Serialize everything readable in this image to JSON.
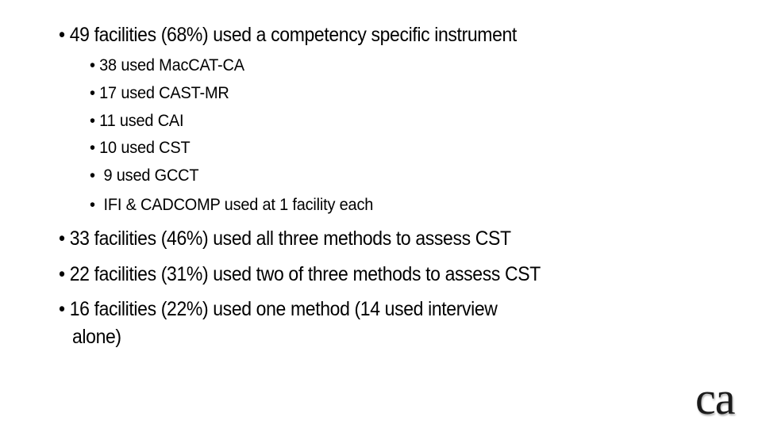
{
  "slide": {
    "main_bullets_top": [
      {
        "bullet": "•",
        "text": "49 facilities (68%) used a competency specific instrument"
      }
    ],
    "sub_bullets": [
      {
        "bullet": "•",
        "text": "38 used MacCAT-CA"
      },
      {
        "bullet": "•",
        "text": "17 used CAST-MR"
      },
      {
        "bullet": "•",
        "text": "11 used CAI"
      },
      {
        "bullet": "•",
        "text": "10 used CST"
      },
      {
        "bullet": "•",
        "text": " 9 used GCCT"
      },
      {
        "bullet": "•",
        "text": " IFI & CADCOMP used at 1 facility each"
      }
    ],
    "main_bullets_bottom": [
      {
        "bullet": "•",
        "text": "33 facilities (46%) used all three methods to assess CST"
      },
      {
        "bullet": "•",
        "text": "22 facilities (31%) used two of three methods to assess CST"
      },
      {
        "bullet": "•",
        "text": "16 facilities (22%) used one method (14 used interview",
        "continuation": "alone)"
      }
    ]
  },
  "logo": {
    "text": "ca"
  }
}
